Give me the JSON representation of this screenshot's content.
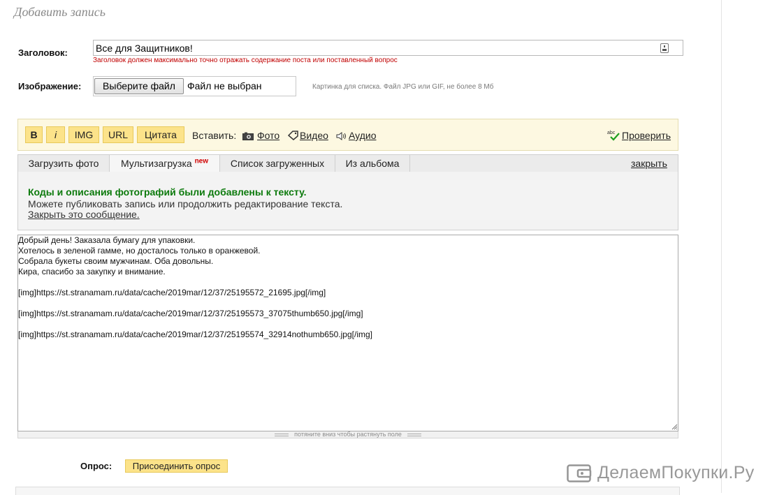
{
  "page": {
    "title": "Добавить запись"
  },
  "form": {
    "title_label": "Заголовок:",
    "title_value": "Все для Защитников!",
    "title_hint": "Заголовок должен максимально точно отражать содержание поста или поставленный вопрос",
    "image_label": "Изображение:",
    "file_button": "Выберите файл",
    "file_status": "Файл не выбран",
    "image_hint": "Картинка для списка. Файл JPG или GIF, не более 8 Мб"
  },
  "toolbar": {
    "bold": "B",
    "italic": "i",
    "img": "IMG",
    "url": "URL",
    "quote": "Цитата",
    "insert_label": "Вставить:",
    "photo": "Фото",
    "video": "Видео",
    "audio": "Аудио",
    "check": "Проверить"
  },
  "tabs": {
    "items": [
      {
        "label": "Загрузить фото"
      },
      {
        "label": "Мультизагрузка",
        "badge": "new"
      },
      {
        "label": "Список загруженных"
      },
      {
        "label": "Из альбома"
      }
    ],
    "close": "закрыть"
  },
  "message": {
    "success": "Коды и описания фотографий были добавлены к тексту.",
    "info": "Можете публиковать запись или продолжить редактирование текста.",
    "close": "Закрыть это сообщение."
  },
  "editor": {
    "lines": [
      "Добрый день! Заказала бумагу для упаковки.",
      "Хотелось в зеленой гамме, но досталось только в оранжевой.",
      "Собрала букеты своим мужчинам. Оба довольны.",
      "Кира, спасибо за закупку и внимание.",
      "",
      "[img]https://st.stranamam.ru/data/cache/2019mar/12/37/25195572_21695.jpg[/img]",
      "",
      "[img]https://st.stranamam.ru/data/cache/2019mar/12/37/25195573_37075thumb650.jpg[/img]",
      "",
      "[img]https://st.stranamam.ru/data/cache/2019mar/12/37/25195574_32914nothumb650.jpg[/img]"
    ],
    "stretch_hint": "потяните вниз чтобы растянуть поле"
  },
  "poll": {
    "label": "Опрос:",
    "button": "Присоединить опрос"
  },
  "watermark": {
    "text": "ДелаемПокупки.Ру"
  },
  "icons": {
    "keyboard": "keyboard-icon",
    "camera": "camera-icon",
    "video": "video-tag-icon",
    "audio": "speaker-icon",
    "spellcheck": "spellcheck-icon",
    "wallet": "wallet-icon"
  },
  "colors": {
    "toolbar_bg": "#fdf8e1",
    "button_yellow": "#fce38a",
    "success_green": "#0c7a0c",
    "hint_red": "#c00000"
  }
}
